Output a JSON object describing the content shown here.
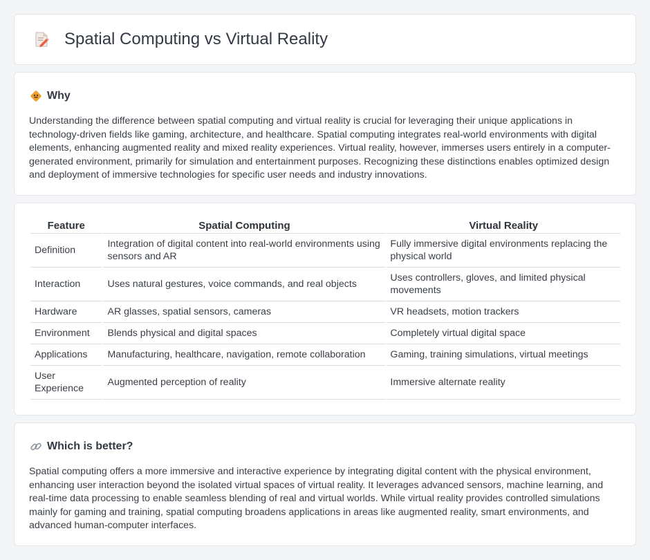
{
  "page": {
    "title": "Spatial Computing vs Virtual Reality"
  },
  "why": {
    "heading": "Why",
    "body": "Understanding the difference between spatial computing and virtual reality is crucial for leveraging their unique applications in technology-driven fields like gaming, architecture, and healthcare. Spatial computing integrates real-world environments with digital elements, enhancing augmented reality and mixed reality experiences. Virtual reality, however, immerses users entirely in a computer-generated environment, primarily for simulation and entertainment purposes. Recognizing these distinctions enables optimized design and deployment of immersive technologies for specific user needs and industry innovations."
  },
  "comparison": {
    "headers": [
      "Feature",
      "Spatial Computing",
      "Virtual Reality"
    ],
    "rows": [
      [
        "Definition",
        "Integration of digital content into real-world environments using sensors and AR",
        "Fully immersive digital environments replacing the physical world"
      ],
      [
        "Interaction",
        "Uses natural gestures, voice commands, and real objects",
        "Uses controllers, gloves, and limited physical movements"
      ],
      [
        "Hardware",
        "AR glasses, spatial sensors, cameras",
        "VR headsets, motion trackers"
      ],
      [
        "Environment",
        "Blends physical and digital spaces",
        "Completely virtual digital space"
      ],
      [
        "Applications",
        "Manufacturing, healthcare, navigation, remote collaboration",
        "Gaming, training simulations, virtual meetings"
      ],
      [
        "User Experience",
        "Augmented perception of reality",
        "Immersive alternate reality"
      ]
    ]
  },
  "better": {
    "heading": "Which is better?",
    "body": "Spatial computing offers a more immersive and interactive experience by integrating digital content with the physical environment, enhancing user interaction beyond the isolated virtual spaces of virtual reality. It leverages advanced sensors, machine learning, and real-time data processing to enable seamless blending of real and virtual worlds. While virtual reality provides controlled simulations mainly for gaming and training, spatial computing broadens applications in areas like augmented reality, smart environments, and advanced human-computer interfaces."
  },
  "icons": {
    "title": "document-pencil-icon",
    "why": "diamond-sign-icon",
    "better": "link-icon"
  },
  "colors": {
    "background": "#f4f5f7",
    "card": "#ffffff",
    "border": "#e3e6ea",
    "why_icon": "#f0a030",
    "link_icon": "#8a93a0"
  }
}
